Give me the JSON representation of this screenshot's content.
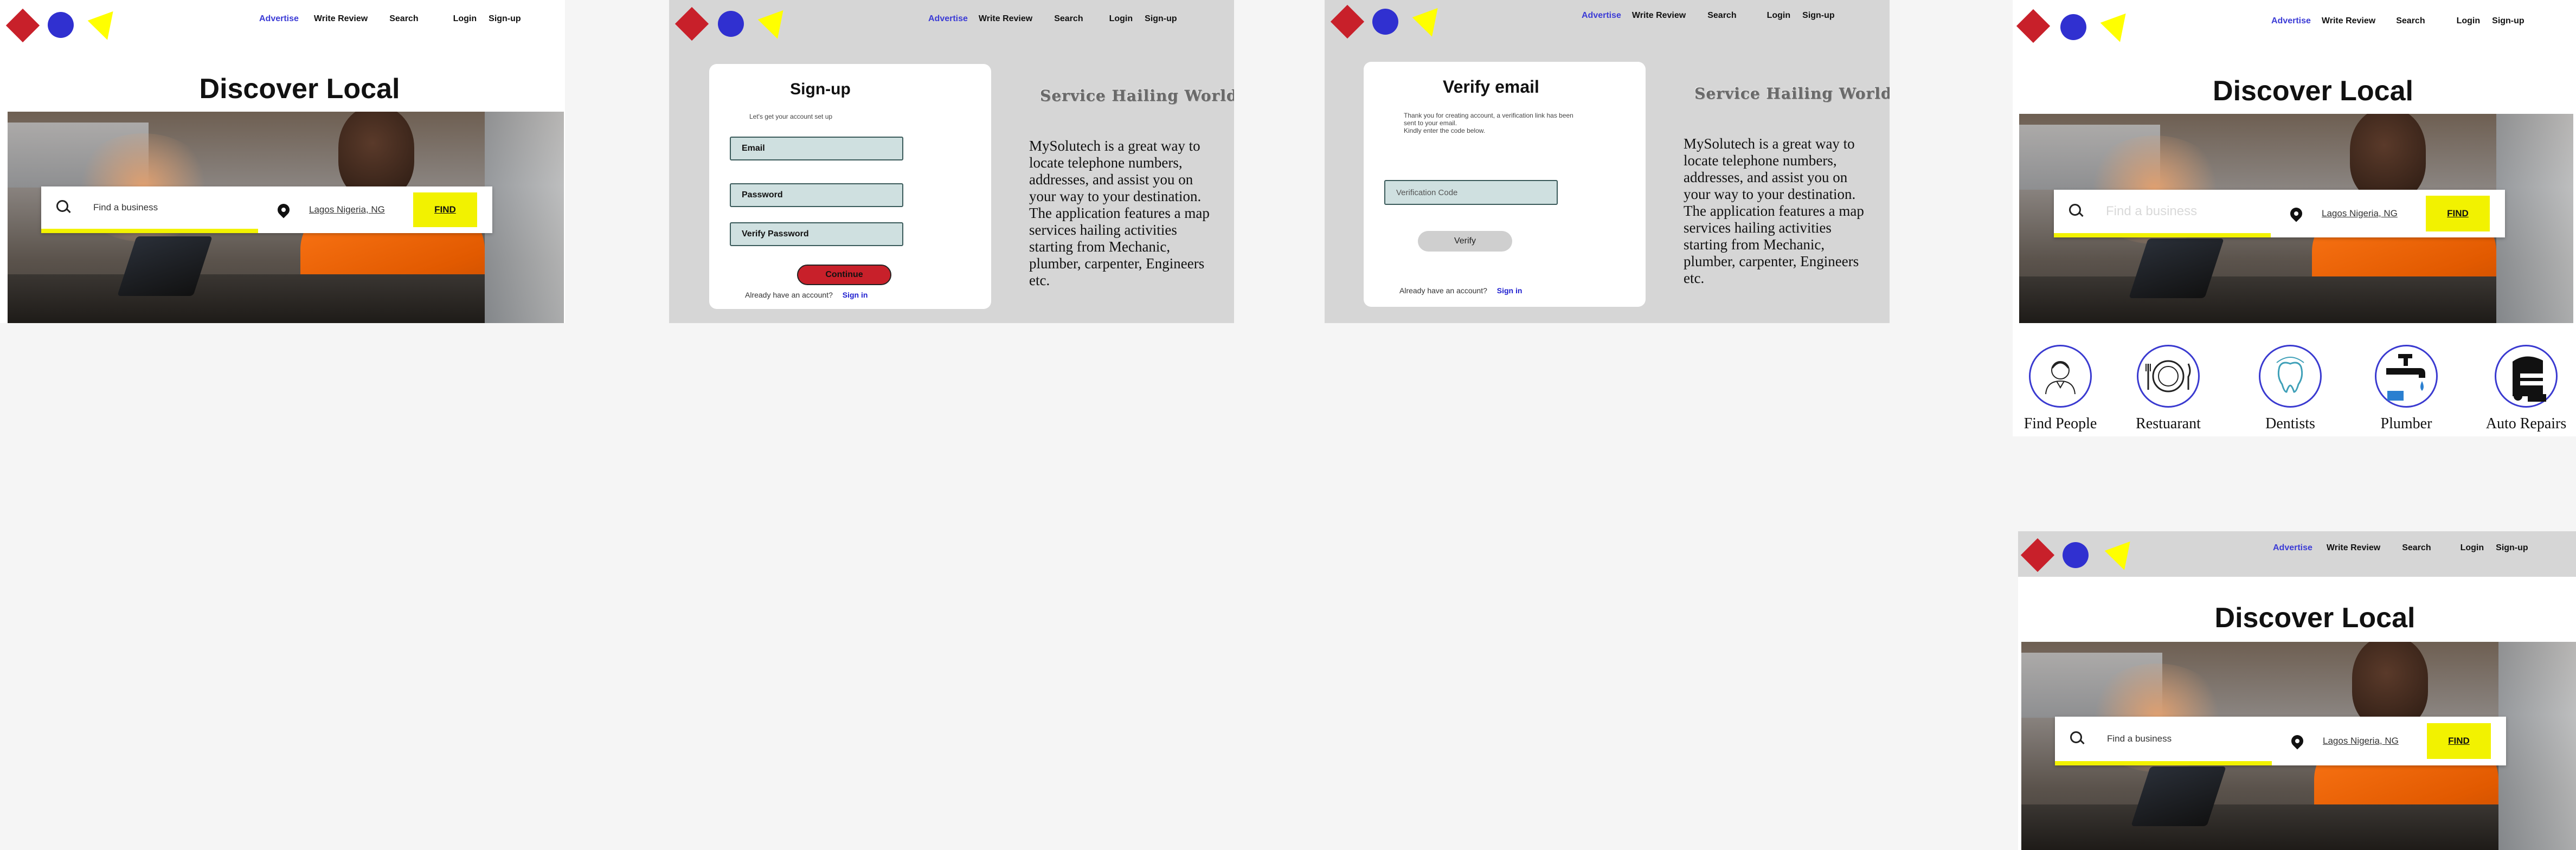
{
  "nav": {
    "advertise": "Advertise",
    "write_review": "Write Review",
    "search": "Search",
    "login": "Login",
    "signup": "Sign-up"
  },
  "home": {
    "title": "Discover Local",
    "search_placeholder": "Find a business",
    "location": "Lagos Nigeria, NG",
    "find_button": "FIND"
  },
  "signup": {
    "title": "Sign-up",
    "subtitle": "Let's get your account set up",
    "email_label": "Email",
    "password_label": "Password",
    "verify_password_label": "Verify Password",
    "continue_button": "Continue",
    "have_account": "Already have an account?",
    "signin_link": "Sign in"
  },
  "verify": {
    "title": "Verify email",
    "message_line1": "Thank you for creating account, a verification link has been",
    "message_line2": "sent to your email.",
    "message_line3": "Kindly enter the code below.",
    "code_placeholder": "Verification Code",
    "verify_button": "Verify",
    "have_account": "Already have an account?",
    "signin_link": "Sign in"
  },
  "side": {
    "heading": "Service Hailing World",
    "body": "MySolutech is a great way to locate telephone numbers, addresses, and assist you on your way to your destination. The application features a map services hailing activities starting from Mechanic, plumber, carpenter, Engineers etc."
  },
  "categories": [
    {
      "label": "Find People",
      "icon": "person-icon"
    },
    {
      "label": "Restuarant",
      "icon": "plate-icon"
    },
    {
      "label": "Dentists",
      "icon": "tooth-icon"
    },
    {
      "label": "Plumber",
      "icon": "faucet-icon"
    },
    {
      "label": "Auto Repairs",
      "icon": "car-icon"
    }
  ],
  "colors": {
    "accent_yellow": "#f2f200",
    "logo_red": "#c8202a",
    "logo_blue": "#3030d0",
    "link_blue": "#3b3bd6",
    "continue_red": "#c8202a"
  }
}
